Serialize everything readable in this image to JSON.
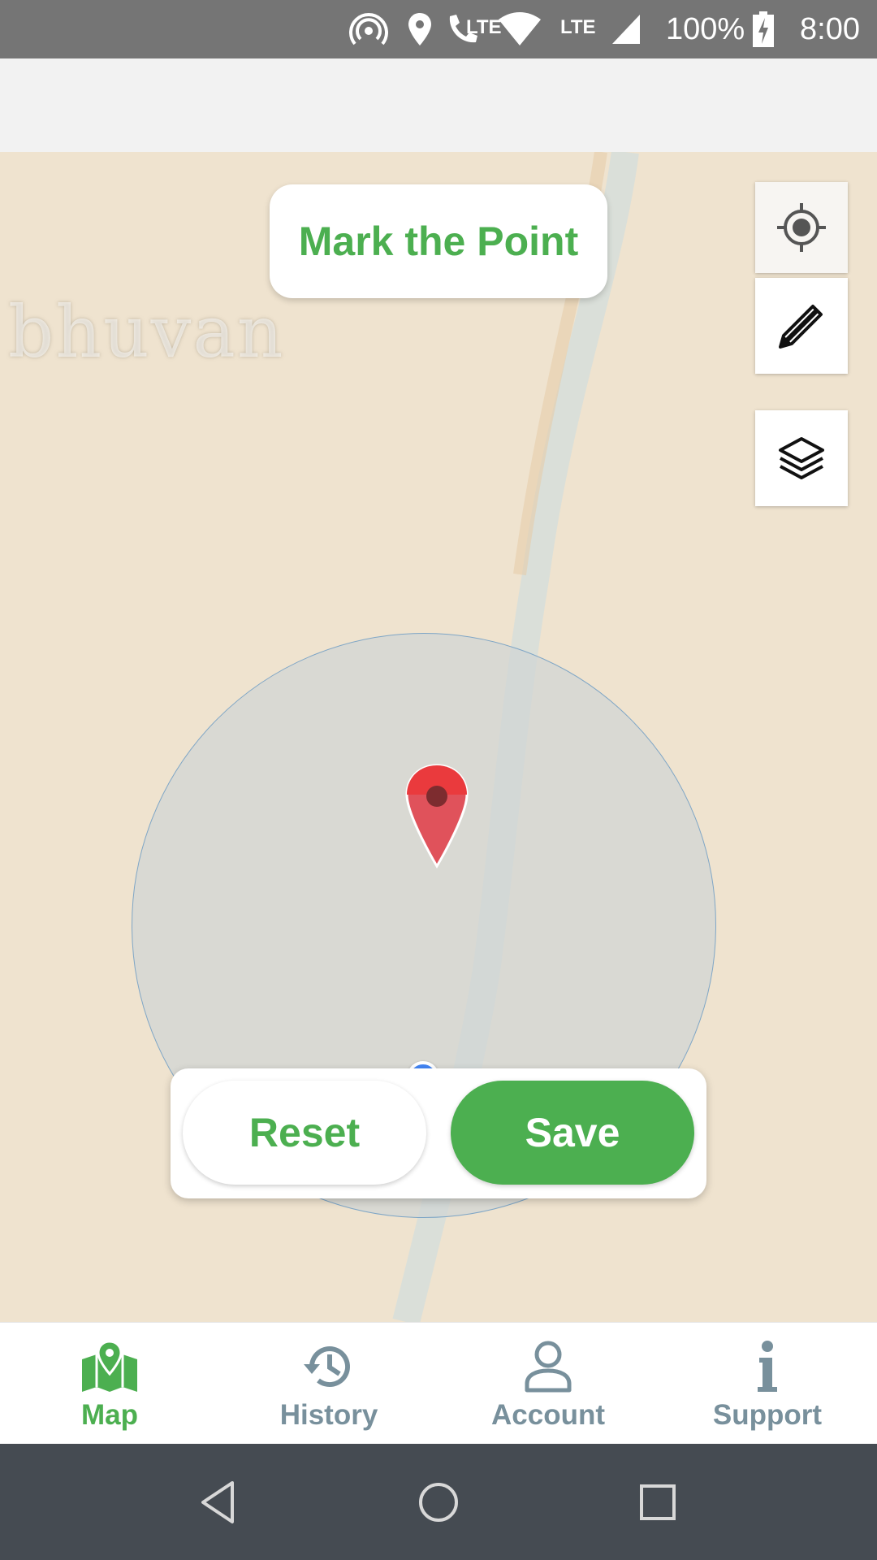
{
  "status_bar": {
    "lte_small": "LTE",
    "lte": "LTE",
    "battery": "100%",
    "time": "8:00",
    "icons": [
      "hotspot-icon",
      "location-icon",
      "volte-call-icon",
      "wifi-icon",
      "signal-icon",
      "battery-charging-icon"
    ]
  },
  "map": {
    "watermark": "bhuvan",
    "mark_point_label": "Mark the Point",
    "controls": [
      "my-location-icon",
      "pencil-icon",
      "layers-icon"
    ]
  },
  "actions": {
    "reset_label": "Reset",
    "save_label": "Save"
  },
  "bottom_nav": {
    "items": [
      {
        "label": "Map",
        "icon": "map-icon",
        "active": true
      },
      {
        "label": "History",
        "icon": "history-icon",
        "active": false
      },
      {
        "label": "Account",
        "icon": "account-icon",
        "active": false
      },
      {
        "label": "Support",
        "icon": "info-icon",
        "active": false
      }
    ]
  },
  "colors": {
    "accent": "#4caf50",
    "inactive": "#78909c",
    "map_bg": "#efe3cf",
    "marker": "#e53935",
    "location": "#4285f4"
  }
}
